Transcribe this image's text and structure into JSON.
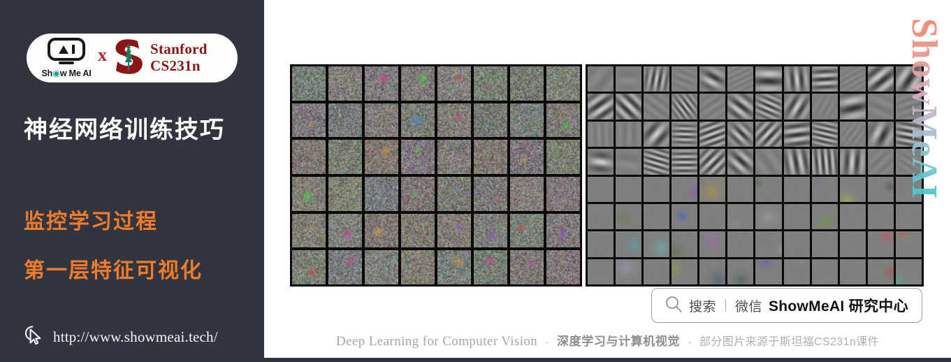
{
  "colors": {
    "sidebar_bg": "#30353F",
    "accent_orange": "#F07B2A",
    "stanford_red": "#8C1515",
    "panel_bg": "#FFFFFF",
    "grid_separator": "#0A0A0A"
  },
  "sidebar": {
    "logo": {
      "brand_name": "Show Me AI",
      "cross_symbol": "x",
      "partner_line1": "Stanford",
      "partner_line2": "CS231n",
      "stanford_icon": "stanford-tree-s-icon"
    },
    "title": "神经网络训练技巧",
    "subtitle_1": "监控学习过程",
    "subtitle_2": "第一层特征可视化",
    "url": "http://www.showmeai.tech/",
    "cursor_icon": "mouse-pointer-icon"
  },
  "main": {
    "watermark": "ShowMeAI",
    "search": {
      "icon": "search-icon",
      "label": "搜索",
      "separator": "|",
      "channel": "微信",
      "brand": "ShowMeAI 研究中心"
    },
    "footer": {
      "english": "Deep Learning for Computer Vision",
      "dot": "·",
      "chinese_bold": "深度学习与计算机视觉",
      "chinese_note": "部分图片来源于斯坦福CS231n课件"
    },
    "figures": [
      {
        "name": "first-layer-weights-noisy",
        "type": "filter-grid",
        "columns": 8,
        "rows": 6,
        "style": "noisy-rgb-unconverged"
      },
      {
        "name": "first-layer-weights-gabor",
        "type": "filter-grid",
        "columns": 12,
        "rows": 8,
        "style": "gabor-and-color-blobs"
      }
    ]
  },
  "chart_data": {
    "type": "heatmap",
    "title": "First layer convolutional filter visualizations",
    "panels": [
      {
        "label": "noisy / poorly trained first-layer filters",
        "grid": [
          8,
          6
        ],
        "cell_count": 48,
        "appearance": "high-frequency RGB noise, desaturated gray-green base with scattered magenta/blue/green blobs"
      },
      {
        "label": "well trained first-layer filters",
        "grid": [
          12,
          8
        ],
        "cell_count": 96,
        "appearance": "oriented gabor edge filters in upper rows, low-frequency color blobs in lower rows"
      }
    ]
  }
}
